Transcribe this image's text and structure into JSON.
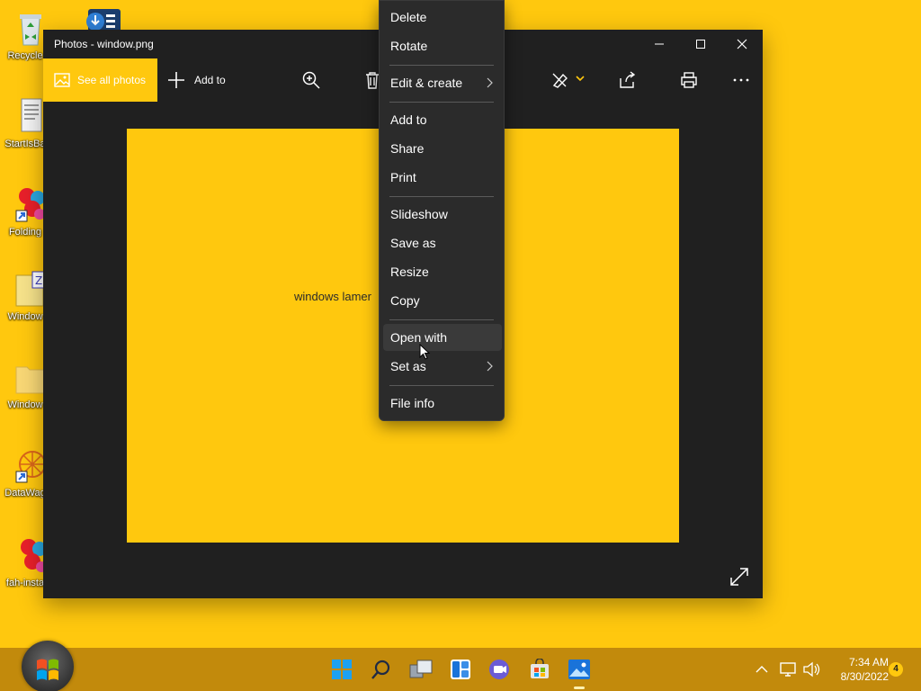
{
  "desktop": {
    "icons": [
      {
        "label": "Recycle",
        "icon": "recycle-bin-icon"
      },
      {
        "label": "StartIsBa",
        "icon": "document-icon"
      },
      {
        "label": "Folding",
        "icon": "folding-at-home-icon"
      },
      {
        "label": "Window",
        "icon": "archive-folder-icon"
      },
      {
        "label": "Window",
        "icon": "folder-icon"
      },
      {
        "label": "DataWag",
        "icon": "datawag-icon"
      },
      {
        "label": "fah-insta",
        "icon": "fah-installer-icon"
      }
    ]
  },
  "window": {
    "title": "Photos - window.png",
    "toolbar": {
      "see_all_label": "See all photos",
      "add_to_label": "Add to"
    },
    "image_text": "windows lamer"
  },
  "context_menu": {
    "items": [
      {
        "label": "Delete"
      },
      {
        "label": "Rotate"
      },
      {
        "label": "Edit & create",
        "submenu": true
      },
      {
        "label": "Add to"
      },
      {
        "label": "Share"
      },
      {
        "label": "Print"
      },
      {
        "label": "Slideshow"
      },
      {
        "label": "Save as"
      },
      {
        "label": "Resize"
      },
      {
        "label": "Copy"
      },
      {
        "label": "Open with",
        "hovered": true
      },
      {
        "label": "Set as",
        "submenu": true
      },
      {
        "label": "File info"
      }
    ]
  },
  "taskbar": {
    "apps": [
      "start-icon",
      "search-icon",
      "task-view-icon",
      "widgets-icon",
      "chat-icon",
      "store-icon",
      "photos-icon"
    ],
    "clock": {
      "time": "7:34 AM",
      "date": "8/30/2022"
    },
    "notification_count": "4"
  },
  "colors": {
    "desktop_bg": "#ffc80e",
    "window_bg": "#202020",
    "menu_bg": "#2b2b2b",
    "taskbar_bg": "#c28a0c",
    "accent": "#ffc80e"
  }
}
